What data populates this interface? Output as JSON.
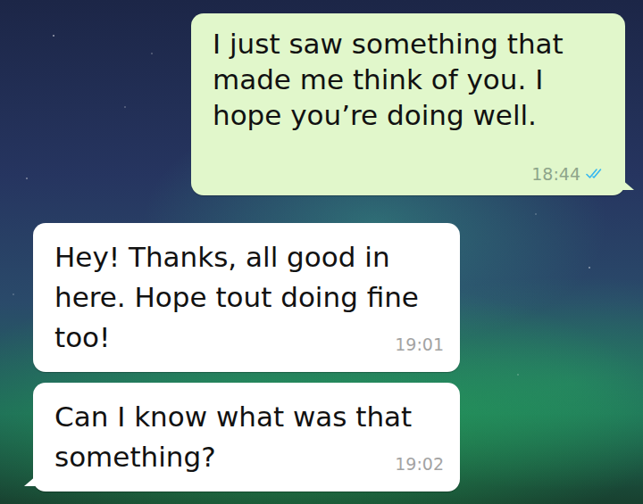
{
  "messages": [
    {
      "kind": "outgoing",
      "text": "I just saw something that made me think of you. I hope you’re doing well.",
      "time": "18:44",
      "read": true
    },
    {
      "kind": "incoming",
      "text": "Hey! Thanks, all good in here. Hope tout doing fine too!",
      "time": "19:01"
    },
    {
      "kind": "incoming",
      "text": "Can I know what was that something?",
      "time": "19:02"
    }
  ]
}
